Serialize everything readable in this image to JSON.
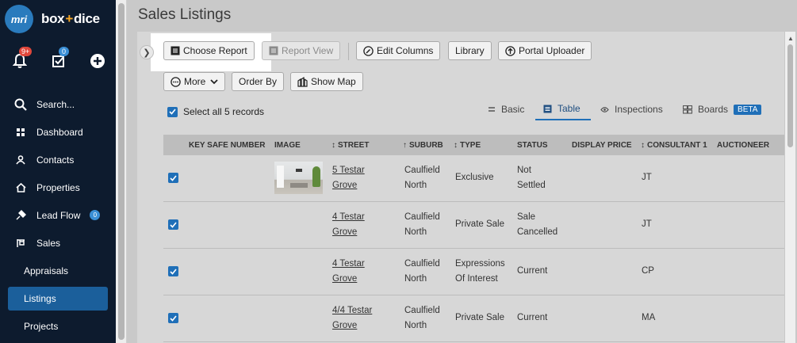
{
  "sidebar": {
    "logo": "mri",
    "brand_part1": "box",
    "brand_plus": "+",
    "brand_part2": "dice",
    "notifications_badge": "9+",
    "tasks_badge": "0",
    "search_label": "Search...",
    "items": [
      {
        "label": "Dashboard",
        "icon": "grid-icon"
      },
      {
        "label": "Contacts",
        "icon": "person-icon"
      },
      {
        "label": "Properties",
        "icon": "home-icon"
      },
      {
        "label": "Lead Flow",
        "icon": "lead-icon",
        "badge": "0"
      },
      {
        "label": "Sales",
        "icon": "sign-icon"
      }
    ],
    "sub_items": [
      {
        "label": "Appraisals"
      },
      {
        "label": "Listings",
        "active": true
      },
      {
        "label": "Projects"
      }
    ]
  },
  "header": {
    "title": "Sales Listings"
  },
  "toolbar": {
    "choose_report": "Choose Report",
    "report_view": "Report View",
    "edit_columns": "Edit Columns",
    "library": "Library",
    "portal_uploader": "Portal Uploader",
    "more": "More",
    "order_by": "Order By",
    "show_map": "Show Map"
  },
  "selection": {
    "select_all_label": "Select all 5 records"
  },
  "view_tabs": {
    "basic": "Basic",
    "table": "Table",
    "inspections": "Inspections",
    "boards": "Boards",
    "beta": "BETA",
    "active": "Table"
  },
  "table": {
    "columns": [
      "KEY SAFE NUMBER",
      "IMAGE",
      "STREET",
      "SUBURB",
      "TYPE",
      "STATUS",
      "DISPLAY PRICE",
      "CONSULTANT 1",
      "AUCTIONEER"
    ],
    "rows": [
      {
        "street_1": "5 Testar",
        "street_2": "Grove",
        "suburb_1": "Caulfield",
        "suburb_2": "North",
        "type_1": "Exclusive",
        "type_2": "",
        "status_1": "Not",
        "status_2": "Settled",
        "consultant": "JT",
        "has_image": true
      },
      {
        "street_1": "4 Testar",
        "street_2": "Grove",
        "suburb_1": "Caulfield",
        "suburb_2": "North",
        "type_1": "Private Sale",
        "type_2": "",
        "status_1": "Sale",
        "status_2": "Cancelled",
        "consultant": "JT",
        "has_image": false
      },
      {
        "street_1": "4 Testar",
        "street_2": "Grove",
        "suburb_1": "Caulfield",
        "suburb_2": "North",
        "type_1": "Expressions",
        "type_2": "Of Interest",
        "status_1": "Current",
        "status_2": "",
        "consultant": "CP",
        "has_image": false
      },
      {
        "street_1": "4/4 Testar",
        "street_2": "Grove",
        "suburb_1": "Caulfield",
        "suburb_2": "North",
        "type_1": "Private Sale",
        "type_2": "",
        "status_1": "Current",
        "status_2": "",
        "consultant": "MA",
        "has_image": false
      }
    ]
  },
  "colors": {
    "sidebar_bg": "#0d1b2e",
    "active_nav": "#1b5f9b",
    "accent": "#1f6fb8",
    "badge_red": "#e0473b"
  }
}
